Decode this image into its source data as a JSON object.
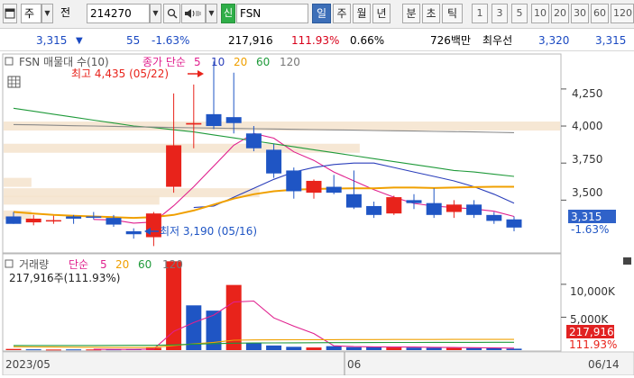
{
  "toolbar": {
    "period_type": "주",
    "prefix": "전",
    "code": "214270",
    "signal": "신",
    "name": "FSN",
    "period_tabs": [
      "일",
      "주",
      "월",
      "년",
      "분",
      "초",
      "틱"
    ],
    "active_tab": "일",
    "interval_buttons": [
      "1",
      "3",
      "5",
      "10",
      "20",
      "30",
      "60",
      "120"
    ]
  },
  "quote": {
    "price": "3,315",
    "change": "55",
    "change_pct": "-1.63%",
    "volume": "217,916",
    "volume_ratio": "111.93%",
    "turnover": "0.66%",
    "amount": "726백만",
    "bid_label": "최우선",
    "bid": "3,320",
    "ask": "3,315"
  },
  "price_panel": {
    "title": "FSN 매물대 수(10)",
    "ma_label": "종가 단순",
    "ma_periods": [
      "5",
      "10",
      "20",
      "60",
      "120"
    ],
    "high_label": "최고 4,435 (05/22)",
    "low_label": "최저 3,190 (05/16)",
    "y_ticks": [
      "4,250",
      "4,000",
      "3,750",
      "3,500"
    ],
    "current_price": "3,315",
    "current_change": "-1.63%"
  },
  "volume_panel": {
    "title": "거래량",
    "ma_label": "단순",
    "ma_periods": [
      "5",
      "20",
      "60",
      "120"
    ],
    "current_label": "217,916주(111.93%)",
    "y_ticks": [
      "10,000K",
      "5,000K"
    ],
    "current_volume": "217,916",
    "current_pct": "111.93%"
  },
  "x_axis": {
    "labels": [
      "2023/05",
      "06",
      "06/14"
    ]
  },
  "colors": {
    "up": "#e8231b",
    "down": "#1f55c4",
    "ma5": "#e0208e",
    "ma10": "#2b3fbb",
    "ma20": "#f0a000",
    "ma60": "#1f9a3a",
    "profile": "#f5e3cc",
    "current_price_bg": "#2f62c9",
    "current_vol_bg": "#e12222"
  },
  "chart_data": {
    "type": "candlestick",
    "price_axis": {
      "ylim": [
        3150,
        4480
      ]
    },
    "candles": [
      {
        "o": 3390,
        "h": 3420,
        "l": 3340,
        "c": 3340
      },
      {
        "o": 3350,
        "h": 3400,
        "l": 3330,
        "c": 3375
      },
      {
        "o": 3360,
        "h": 3395,
        "l": 3340,
        "c": 3365
      },
      {
        "o": 3390,
        "h": 3400,
        "l": 3340,
        "c": 3375
      },
      {
        "o": 3390,
        "h": 3420,
        "l": 3370,
        "c": 3385
      },
      {
        "o": 3380,
        "h": 3400,
        "l": 3320,
        "c": 3335
      },
      {
        "o": 3290,
        "h": 3310,
        "l": 3240,
        "c": 3270
      },
      {
        "o": 3250,
        "h": 3420,
        "l": 3190,
        "c": 3410
      },
      {
        "o": 3590,
        "h": 4220,
        "l": 3550,
        "c": 3870
      },
      {
        "o": 4010,
        "h": 4280,
        "l": 3850,
        "c": 4020
      },
      {
        "o": 4080,
        "h": 4435,
        "l": 3980,
        "c": 4000
      },
      {
        "o": 4060,
        "h": 4360,
        "l": 3950,
        "c": 4020
      },
      {
        "o": 3950,
        "h": 4000,
        "l": 3830,
        "c": 3850
      },
      {
        "o": 3840,
        "h": 3880,
        "l": 3650,
        "c": 3680
      },
      {
        "o": 3700,
        "h": 3720,
        "l": 3510,
        "c": 3560
      },
      {
        "o": 3550,
        "h": 3640,
        "l": 3510,
        "c": 3630
      },
      {
        "o": 3590,
        "h": 3670,
        "l": 3540,
        "c": 3550
      },
      {
        "o": 3540,
        "h": 3700,
        "l": 3440,
        "c": 3450
      },
      {
        "o": 3460,
        "h": 3490,
        "l": 3380,
        "c": 3400
      },
      {
        "o": 3410,
        "h": 3530,
        "l": 3400,
        "c": 3520
      },
      {
        "o": 3500,
        "h": 3540,
        "l": 3440,
        "c": 3480
      },
      {
        "o": 3480,
        "h": 3580,
        "l": 3380,
        "c": 3400
      },
      {
        "o": 3420,
        "h": 3500,
        "l": 3380,
        "c": 3470
      },
      {
        "o": 3470,
        "h": 3500,
        "l": 3380,
        "c": 3400
      },
      {
        "o": 3400,
        "h": 3420,
        "l": 3340,
        "c": 3360
      },
      {
        "o": 3370,
        "h": 3390,
        "l": 3290,
        "c": 3315
      }
    ],
    "ma": {
      "ma5": [
        null,
        null,
        null,
        null,
        3370,
        3366,
        3345,
        3352,
        3462,
        3590,
        3730,
        3870,
        3950,
        3918,
        3826,
        3768,
        3690,
        3630,
        3570,
        3520,
        3478,
        3460,
        3450,
        3440,
        3425,
        3390
      ],
      "ma10": [
        null,
        null,
        null,
        null,
        null,
        null,
        null,
        null,
        null,
        3450,
        3460,
        3520,
        3580,
        3640,
        3690,
        3720,
        3740,
        3750,
        3750,
        3720,
        3690,
        3660,
        3630,
        3590,
        3540,
        3480
      ],
      "ma20": [
        3420,
        3410,
        3400,
        3395,
        3390,
        3385,
        3380,
        3385,
        3400,
        3430,
        3470,
        3510,
        3540,
        3560,
        3570,
        3575,
        3578,
        3580,
        3580,
        3585,
        3585,
        3582,
        3585,
        3588,
        3590,
        3590
      ],
      "ma60": [
        4120,
        4100,
        4080,
        4060,
        4040,
        4020,
        4000,
        3990,
        3975,
        3960,
        3940,
        3920,
        3900,
        3880,
        3860,
        3840,
        3820,
        3800,
        3780,
        3760,
        3740,
        3720,
        3700,
        3690,
        3675,
        3660
      ],
      "ma120": [
        4010,
        4008,
        4005,
        4002,
        4000,
        3998,
        3995,
        3993,
        3990,
        3988,
        3986,
        3984,
        3982,
        3980,
        3978,
        3976,
        3974,
        3972,
        3970,
        3968,
        3966,
        3964,
        3962,
        3960,
        3958,
        3955
      ]
    },
    "volume_profile": [
      {
        "price": 4000,
        "rel": 1.0
      },
      {
        "price": 3850,
        "rel": 0.64
      },
      {
        "price": 3550,
        "rel": 0.46
      },
      {
        "price": 3500,
        "rel": 0.28
      },
      {
        "price": 3620,
        "rel": 0.05
      },
      {
        "price": 3400,
        "rel": 0.05
      }
    ],
    "volume_axis": {
      "ylim": [
        0,
        14500
      ]
    },
    "volumes": [
      180,
      120,
      90,
      110,
      100,
      120,
      160,
      350,
      13500,
      6800,
      6000,
      9900,
      1100,
      700,
      500,
      400,
      600,
      450,
      500,
      400,
      380,
      350,
      330,
      320,
      300,
      218
    ],
    "volume_up": [
      true,
      false,
      true,
      false,
      true,
      false,
      false,
      true,
      true,
      false,
      false,
      true,
      false,
      false,
      false,
      true,
      false,
      false,
      false,
      true,
      false,
      false,
      true,
      false,
      false,
      false
    ],
    "volume_ma5": [
      null,
      null,
      null,
      null,
      120,
      108,
      116,
      166,
      2846,
      4186,
      5322,
      7310,
      7460,
      4900,
      3640,
      2520,
      660,
      530,
      490,
      470,
      466,
      420,
      402,
      376,
      340,
      304
    ],
    "volume_ma20": [
      500,
      480,
      460,
      440,
      420,
      400,
      390,
      400,
      700,
      950,
      1180,
      1500,
      1550,
      1560,
      1570,
      1580,
      1590,
      1600,
      1600,
      1610,
      1620,
      1620,
      1625,
      1630,
      1630,
      1630
    ],
    "volume_ma60": [
      700,
      700,
      700,
      700,
      700,
      710,
      720,
      730,
      800,
      900,
      980,
      1050,
      1080,
      1100,
      1110,
      1120,
      1130,
      1140,
      1150,
      1160,
      1165,
      1170,
      1175,
      1180,
      1185,
      1190
    ]
  }
}
